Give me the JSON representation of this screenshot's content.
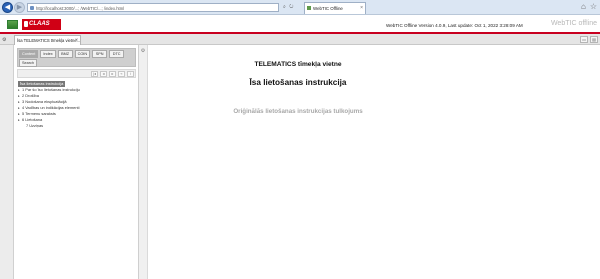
{
  "browser": {
    "url": "http://localhost:3000/...; /WebTIC/...; /index.html",
    "tab_title": "WebTIC Offline",
    "colors": {
      "back_button": "#2a63b8"
    }
  },
  "app": {
    "brand": "CLAAS",
    "version_text": "WebTIC Offline Version 4.0.9, Last update: Oct 1, 2022 3:28:09 AM",
    "product_logo": "WebTIC offline",
    "colors": {
      "brand_red": "#d00015",
      "header_rule": "#c8001f"
    }
  },
  "doc_tab": {
    "title": "Īsa TELEMATICS tīmekļa vietne...",
    "close": "×"
  },
  "sidebar": {
    "tabs": [
      {
        "label": "Content",
        "active": true
      },
      {
        "label": "Index",
        "active": false
      },
      {
        "label": "BMZ",
        "active": false
      },
      {
        "label": "COIN",
        "active": false
      },
      {
        "label": "SPN",
        "active": false
      },
      {
        "label": "DTC",
        "active": false
      },
      {
        "label": "Search",
        "active": false
      }
    ],
    "tree_root": "Īsa lietošanas instrukcija",
    "tree": [
      {
        "label": "1 Par šo īso lietošanas instrukciju",
        "caret": "▸"
      },
      {
        "label": "2 Drošība",
        "caret": "▸"
      },
      {
        "label": "3 Nodošana ekspluatācijā",
        "caret": "▸"
      },
      {
        "label": "4 Vadības un indikācijas elementi",
        "caret": "▸"
      },
      {
        "label": "5 Termenu saraksts",
        "caret": "▸"
      },
      {
        "label": "6 Lietošana",
        "caret": "▸"
      },
      {
        "label": "7 Uzziņas",
        "caret": ""
      }
    ]
  },
  "main": {
    "title": "TELEMATICS tīmekļa vietne",
    "subtitle": "Īsa lietošanas instrukcija",
    "translation_note": "Oriģinālās lietošanas instrukcijas tulkojums"
  }
}
